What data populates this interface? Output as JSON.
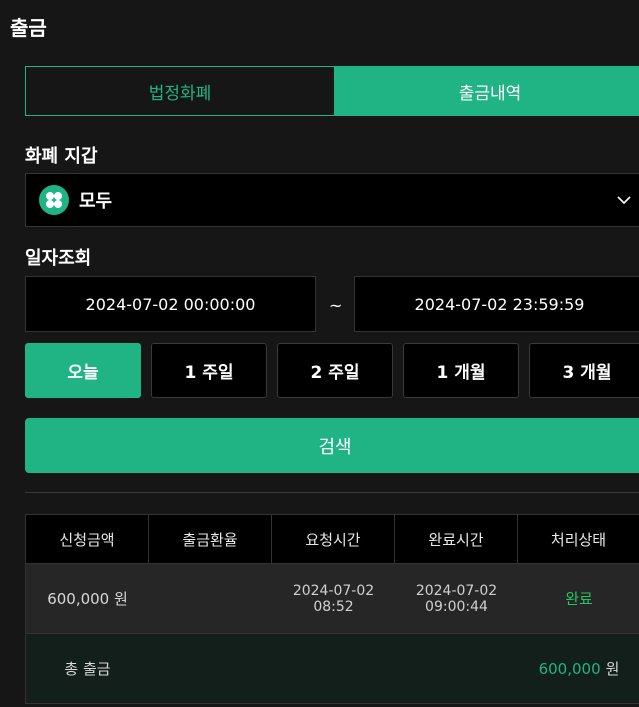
{
  "page_title": "출금",
  "tabs": [
    {
      "label": "법정화폐",
      "active": false
    },
    {
      "label": "출금내역",
      "active": true
    }
  ],
  "currency_wallet": {
    "label": "화폐 지갑",
    "selected": "모두"
  },
  "date_query": {
    "label": "일자조회",
    "start": "2024-07-02 00:00:00",
    "separator": "~",
    "end": "2024-07-02 23:59:59"
  },
  "periods": [
    {
      "label": "오늘",
      "active": true
    },
    {
      "label": "1 주일",
      "active": false
    },
    {
      "label": "2 주일",
      "active": false
    },
    {
      "label": "1 개월",
      "active": false
    },
    {
      "label": "3 개월",
      "active": false
    }
  ],
  "search_label": "검색",
  "table": {
    "headers": [
      "신청금액",
      "출금환율",
      "요청시간",
      "완료시간",
      "처리상태"
    ],
    "rows": [
      {
        "amount": "600,000 원",
        "rate": "",
        "request_date": "2024-07-02",
        "request_time": "08:52",
        "complete_date": "2024-07-02",
        "complete_time": "09:00:44",
        "status": "완료"
      }
    ],
    "total": {
      "label": "총 출금",
      "amount": "600,000",
      "unit": "원"
    }
  },
  "colors": {
    "accent": "#20b485",
    "status_done": "#22c55e",
    "background": "#161616"
  }
}
